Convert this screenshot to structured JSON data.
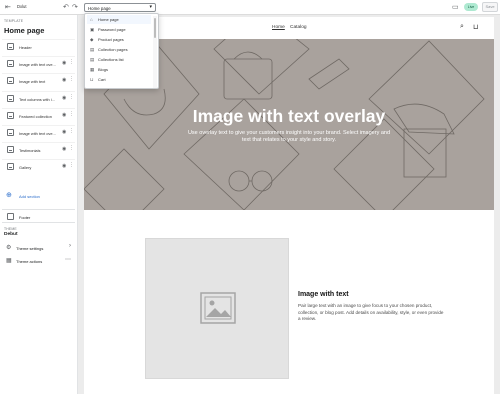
{
  "topbar": {
    "exit_label": "Dxlut",
    "page_select_value": "Home page",
    "live_badge": "Live",
    "save_label": "Save"
  },
  "sidebar": {
    "template_label": "TEMPLATE",
    "title": "Home page",
    "header_label": "Header",
    "sections": [
      {
        "label": "Image with text ove..."
      },
      {
        "label": "Image with text"
      },
      {
        "label": "Text columns with i..."
      },
      {
        "label": "Featured collection"
      },
      {
        "label": "Image with text ove..."
      },
      {
        "label": "Testimonials"
      },
      {
        "label": "Gallery"
      }
    ],
    "add_section_label": "Add section",
    "footer_label": "Footer",
    "theme_label": "THEME",
    "theme_value": "Debut",
    "theme_settings_label": "Theme settings",
    "theme_actions_label": "Theme actions"
  },
  "dropdown": {
    "items": [
      {
        "label": "Home page",
        "icon": "home-icon",
        "glyph": "⌂"
      },
      {
        "label": "Password page",
        "icon": "lock-icon",
        "glyph": "▣"
      },
      {
        "label": "Product pages",
        "icon": "tag-icon",
        "glyph": "◆"
      },
      {
        "label": "Collection pages",
        "icon": "collection-icon",
        "glyph": "▤"
      },
      {
        "label": "Collections list",
        "icon": "list-icon",
        "glyph": "▤"
      },
      {
        "label": "Blogs",
        "icon": "blog-icon",
        "glyph": "▦"
      },
      {
        "label": "Cart",
        "icon": "cart-icon",
        "glyph": "⊔"
      }
    ]
  },
  "preview": {
    "nav": [
      "Home",
      "Catalog"
    ],
    "hero_title": "Image with text overlay",
    "hero_subtitle": "Use overlay text to give your customers insight into your brand. Select imagery and text that relates to your style and story.",
    "iwt_title": "Image with text",
    "iwt_text": "Pair large text with an image to give focus to your chosen product, collection, or blog post. Add details on availability, style, or even provide a review."
  },
  "colors": {
    "hero_bg": "#a9a29d",
    "accent": "#2c6ecb",
    "live_badge": "#aee9d1"
  }
}
